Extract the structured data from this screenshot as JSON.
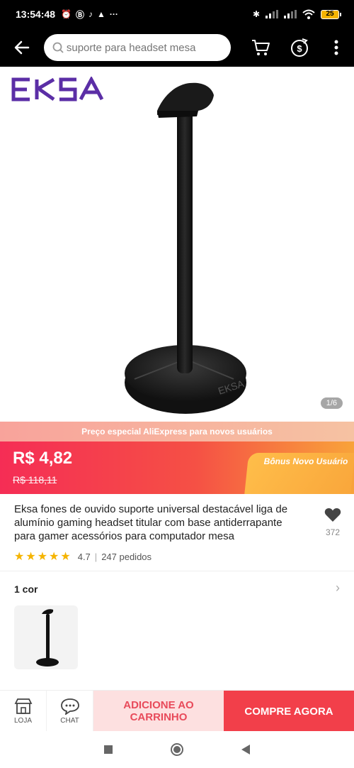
{
  "status_bar": {
    "time": "13:54:48",
    "battery": "25",
    "icons": [
      "alarm-icon",
      "b-icon",
      "tiktok-icon",
      "hat-icon",
      "more-dots-icon"
    ]
  },
  "topbar": {
    "search_placeholder": "suporte para headset mesa"
  },
  "hero": {
    "brand": "EKSA",
    "image_counter": "1/6"
  },
  "promo": {
    "banner": "Preço especial AliExpress para novos usuários",
    "price": "R$ 4,82",
    "old_price": "R$ 118,11",
    "bonus": "Bônus Novo Usuário"
  },
  "product": {
    "title": "Eksa fones de ouvido suporte universal destacável liga de alumínio gaming headset titular com base antiderrapante para gamer acessórios para computador mesa",
    "favorites": "372",
    "rating": "4.7",
    "orders": "247 pedidos",
    "stars": 5
  },
  "variant": {
    "label": "1 cor"
  },
  "bottom_bar": {
    "store_label": "LOJA",
    "chat_label": "CHAT",
    "add_to_cart": "ADICIONE AO CARRINHO",
    "buy_now": "COMPRE AGORA"
  },
  "colors": {
    "accent": "#f23f4a",
    "brand_purple": "#5b2ea6",
    "bonus_orange": "#f9a63b"
  }
}
